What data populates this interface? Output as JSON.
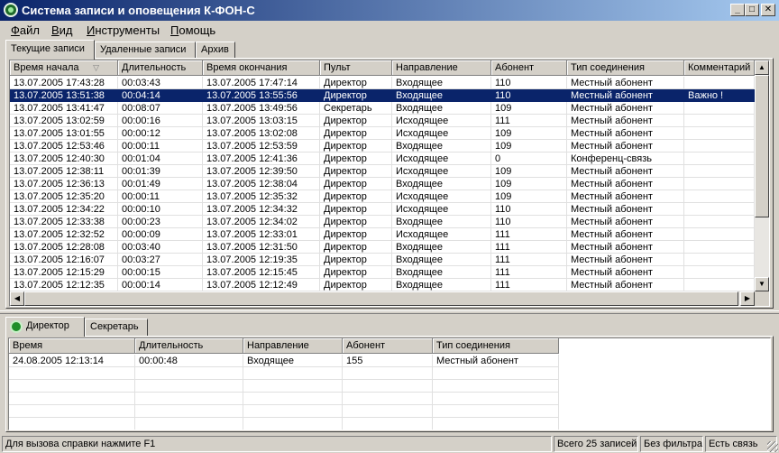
{
  "window": {
    "title": "Система записи и оповещения К-ФОН-С",
    "btn_min": "_",
    "btn_max": "□",
    "btn_close": "✕"
  },
  "menu": [
    {
      "label": "Файл",
      "hot": "Ф",
      "rest": "айл"
    },
    {
      "label": "Вид",
      "hot": "В",
      "rest": "ид"
    },
    {
      "label": "Инструменты",
      "hot": "И",
      "rest": "нструменты"
    },
    {
      "label": "Помощь",
      "hot": "П",
      "rest": "омощь"
    }
  ],
  "top_tabs": [
    "Текущие записи",
    "Удаленные записи",
    "Архив"
  ],
  "records": {
    "columns": [
      "Время начала",
      "Длительность",
      "Время окончания",
      "Пульт",
      "Направление",
      "Абонент",
      "Тип соединения",
      "Комментарий"
    ],
    "sort_indicator": "▽",
    "selected_row": 1,
    "rows": [
      [
        "13.07.2005 17:43:28",
        "00:03:43",
        "13.07.2005 17:47:14",
        "Директор",
        "Входящее",
        "110",
        "Местный абонент",
        ""
      ],
      [
        "13.07.2005 13:51:38",
        "00:04:14",
        "13.07.2005 13:55:56",
        "Директор",
        "Входящее",
        "110",
        "Местный абонент",
        "Важно !"
      ],
      [
        "13.07.2005 13:41:47",
        "00:08:07",
        "13.07.2005 13:49:56",
        "Секретарь",
        "Входящее",
        "109",
        "Местный абонент",
        ""
      ],
      [
        "13.07.2005 13:02:59",
        "00:00:16",
        "13.07.2005 13:03:15",
        "Директор",
        "Исходящее",
        "111",
        "Местный абонент",
        ""
      ],
      [
        "13.07.2005 13:01:55",
        "00:00:12",
        "13.07.2005 13:02:08",
        "Директор",
        "Исходящее",
        "109",
        "Местный абонент",
        ""
      ],
      [
        "13.07.2005 12:53:46",
        "00:00:11",
        "13.07.2005 12:53:59",
        "Директор",
        "Входящее",
        "109",
        "Местный абонент",
        ""
      ],
      [
        "13.07.2005 12:40:30",
        "00:01:04",
        "13.07.2005 12:41:36",
        "Директор",
        "Исходящее",
        "0",
        "Конференц-связь",
        ""
      ],
      [
        "13.07.2005 12:38:11",
        "00:01:39",
        "13.07.2005 12:39:50",
        "Директор",
        "Исходящее",
        "109",
        "Местный абонент",
        ""
      ],
      [
        "13.07.2005 12:36:13",
        "00:01:49",
        "13.07.2005 12:38:04",
        "Директор",
        "Входящее",
        "109",
        "Местный абонент",
        ""
      ],
      [
        "13.07.2005 12:35:20",
        "00:00:11",
        "13.07.2005 12:35:32",
        "Директор",
        "Исходящее",
        "109",
        "Местный абонент",
        ""
      ],
      [
        "13.07.2005 12:34:22",
        "00:00:10",
        "13.07.2005 12:34:32",
        "Директор",
        "Исходящее",
        "110",
        "Местный абонент",
        ""
      ],
      [
        "13.07.2005 12:33:38",
        "00:00:23",
        "13.07.2005 12:34:02",
        "Директор",
        "Входящее",
        "110",
        "Местный абонент",
        ""
      ],
      [
        "13.07.2005 12:32:52",
        "00:00:09",
        "13.07.2005 12:33:01",
        "Директор",
        "Исходящее",
        "111",
        "Местный абонент",
        ""
      ],
      [
        "13.07.2005 12:28:08",
        "00:03:40",
        "13.07.2005 12:31:50",
        "Директор",
        "Входящее",
        "111",
        "Местный абонент",
        ""
      ],
      [
        "13.07.2005 12:16:07",
        "00:03:27",
        "13.07.2005 12:19:35",
        "Директор",
        "Входящее",
        "111",
        "Местный абонент",
        ""
      ],
      [
        "13.07.2005 12:15:29",
        "00:00:15",
        "13.07.2005 12:15:45",
        "Директор",
        "Входящее",
        "111",
        "Местный абонент",
        ""
      ],
      [
        "13.07.2005 12:12:35",
        "00:00:14",
        "13.07.2005 12:12:49",
        "Директор",
        "Входящее",
        "111",
        "Местный абонент",
        ""
      ]
    ]
  },
  "bottom_tabs": [
    "Директор",
    "Секретарь"
  ],
  "console": {
    "columns": [
      "Время",
      "Длительность",
      "Направление",
      "Абонент",
      "Тип соединения"
    ],
    "rows": [
      [
        "24.08.2005 12:13:14",
        "00:00:48",
        "Входящее",
        "155",
        "Местный абонент"
      ]
    ]
  },
  "status": {
    "help": "Для вызова справки нажмите F1",
    "total": "Всего 25 записей",
    "filter": "Без фильтра",
    "connection": "Есть связь"
  },
  "colors": {
    "title_gradient_start": "#0a246a",
    "selection": "#0a246a",
    "face": "#d4d0c8"
  }
}
